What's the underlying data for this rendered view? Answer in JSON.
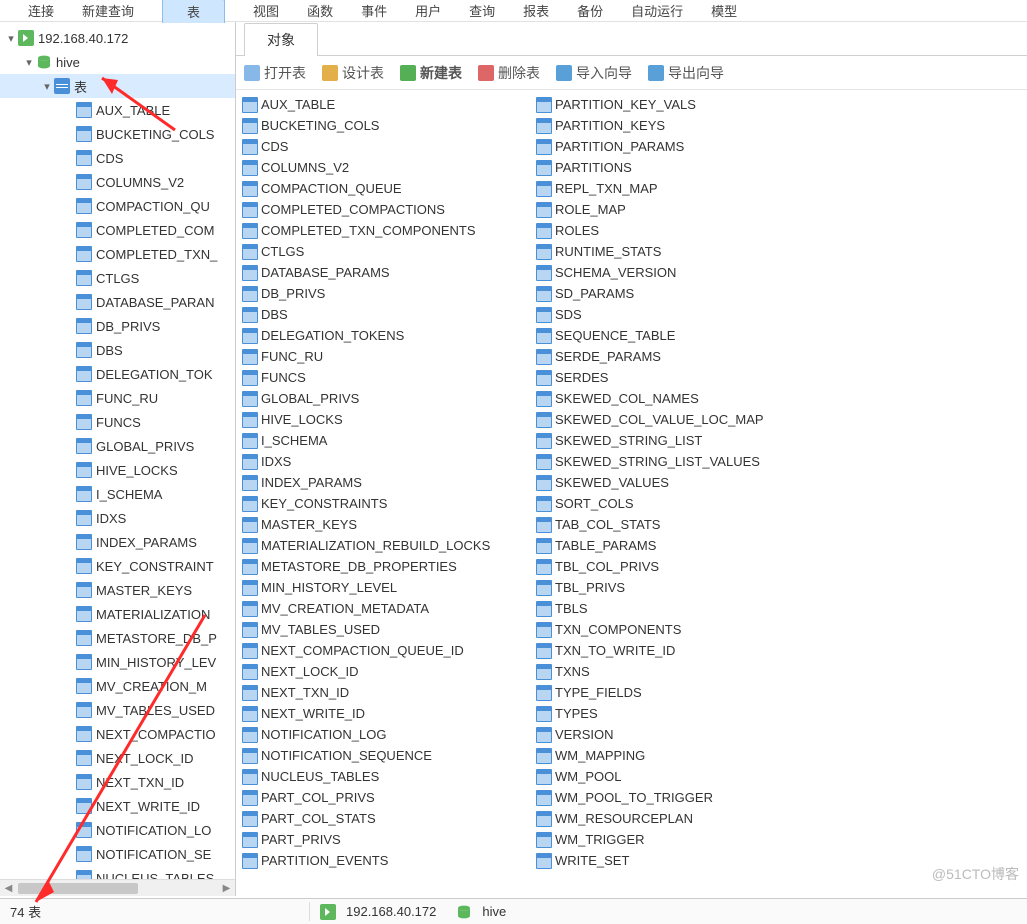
{
  "menu": {
    "items": [
      "连接",
      "新建查询",
      "表",
      "视图",
      "函数",
      "事件",
      "用户",
      "查询",
      "报表",
      "备份",
      "自动运行",
      "模型"
    ],
    "active_index": 2
  },
  "sidebar": {
    "connection": "192.168.40.172",
    "database": "hive",
    "tables_label": "表",
    "tables": [
      "AUX_TABLE",
      "BUCKETING_COLS",
      "CDS",
      "COLUMNS_V2",
      "COMPACTION_QUEUE",
      "COMPLETED_COMPACTIONS",
      "COMPLETED_TXN_COMPONENTS",
      "CTLGS",
      "DATABASE_PARAMS",
      "DB_PRIVS",
      "DBS",
      "DELEGATION_TOKENS",
      "FUNC_RU",
      "FUNCS",
      "GLOBAL_PRIVS",
      "HIVE_LOCKS",
      "I_SCHEMA",
      "IDXS",
      "INDEX_PARAMS",
      "KEY_CONSTRAINTS",
      "MASTER_KEYS",
      "MATERIALIZATION_REBUILD_LOCKS",
      "METASTORE_DB_PROPERTIES",
      "MIN_HISTORY_LEVEL",
      "MV_CREATION_METADATA",
      "MV_TABLES_USED",
      "NEXT_COMPACTION_QUEUE_ID",
      "NEXT_LOCK_ID",
      "NEXT_TXN_ID",
      "NEXT_WRITE_ID",
      "NOTIFICATION_LOG",
      "NOTIFICATION_SEQUENCE",
      "NUCLEUS_TABLES"
    ],
    "tables_display": [
      "AUX_TABLE",
      "BUCKETING_COLS",
      "CDS",
      "COLUMNS_V2",
      "COMPACTION_QU",
      "COMPLETED_COM",
      "COMPLETED_TXN_",
      "CTLGS",
      "DATABASE_PARAN",
      "DB_PRIVS",
      "DBS",
      "DELEGATION_TOK",
      "FUNC_RU",
      "FUNCS",
      "GLOBAL_PRIVS",
      "HIVE_LOCKS",
      "I_SCHEMA",
      "IDXS",
      "INDEX_PARAMS",
      "KEY_CONSTRAINT",
      "MASTER_KEYS",
      "MATERIALIZATION",
      "METASTORE_DB_P",
      "MIN_HISTORY_LEV",
      "MV_CREATION_M",
      "MV_TABLES_USED",
      "NEXT_COMPACTIO",
      "NEXT_LOCK_ID",
      "NEXT_TXN_ID",
      "NEXT_WRITE_ID",
      "NOTIFICATION_LO",
      "NOTIFICATION_SE",
      "NUCLEUS_TABLES"
    ]
  },
  "content": {
    "tab_label": "对象",
    "toolbar": {
      "open": "打开表",
      "design": "设计表",
      "new": "新建表",
      "delete": "删除表",
      "import": "导入向导",
      "export": "导出向导"
    },
    "tables_col1": [
      "AUX_TABLE",
      "BUCKETING_COLS",
      "CDS",
      "COLUMNS_V2",
      "COMPACTION_QUEUE",
      "COMPLETED_COMPACTIONS",
      "COMPLETED_TXN_COMPONENTS",
      "CTLGS",
      "DATABASE_PARAMS",
      "DB_PRIVS",
      "DBS",
      "DELEGATION_TOKENS",
      "FUNC_RU",
      "FUNCS",
      "GLOBAL_PRIVS",
      "HIVE_LOCKS",
      "I_SCHEMA",
      "IDXS",
      "INDEX_PARAMS",
      "KEY_CONSTRAINTS",
      "MASTER_KEYS",
      "MATERIALIZATION_REBUILD_LOCKS",
      "METASTORE_DB_PROPERTIES",
      "MIN_HISTORY_LEVEL",
      "MV_CREATION_METADATA",
      "MV_TABLES_USED",
      "NEXT_COMPACTION_QUEUE_ID",
      "NEXT_LOCK_ID",
      "NEXT_TXN_ID",
      "NEXT_WRITE_ID",
      "NOTIFICATION_LOG",
      "NOTIFICATION_SEQUENCE",
      "NUCLEUS_TABLES",
      "PART_COL_PRIVS",
      "PART_COL_STATS",
      "PART_PRIVS",
      "PARTITION_EVENTS"
    ],
    "tables_col2": [
      "PARTITION_KEY_VALS",
      "PARTITION_KEYS",
      "PARTITION_PARAMS",
      "PARTITIONS",
      "REPL_TXN_MAP",
      "ROLE_MAP",
      "ROLES",
      "RUNTIME_STATS",
      "SCHEMA_VERSION",
      "SD_PARAMS",
      "SDS",
      "SEQUENCE_TABLE",
      "SERDE_PARAMS",
      "SERDES",
      "SKEWED_COL_NAMES",
      "SKEWED_COL_VALUE_LOC_MAP",
      "SKEWED_STRING_LIST",
      "SKEWED_STRING_LIST_VALUES",
      "SKEWED_VALUES",
      "SORT_COLS",
      "TAB_COL_STATS",
      "TABLE_PARAMS",
      "TBL_COL_PRIVS",
      "TBL_PRIVS",
      "TBLS",
      "TXN_COMPONENTS",
      "TXN_TO_WRITE_ID",
      "TXNS",
      "TYPE_FIELDS",
      "TYPES",
      "VERSION",
      "WM_MAPPING",
      "WM_POOL",
      "WM_POOL_TO_TRIGGER",
      "WM_RESOURCEPLAN",
      "WM_TRIGGER",
      "WRITE_SET"
    ]
  },
  "status": {
    "count_label": "74 表",
    "host": "192.168.40.172",
    "db": "hive"
  },
  "watermark": "@51CTO博客"
}
